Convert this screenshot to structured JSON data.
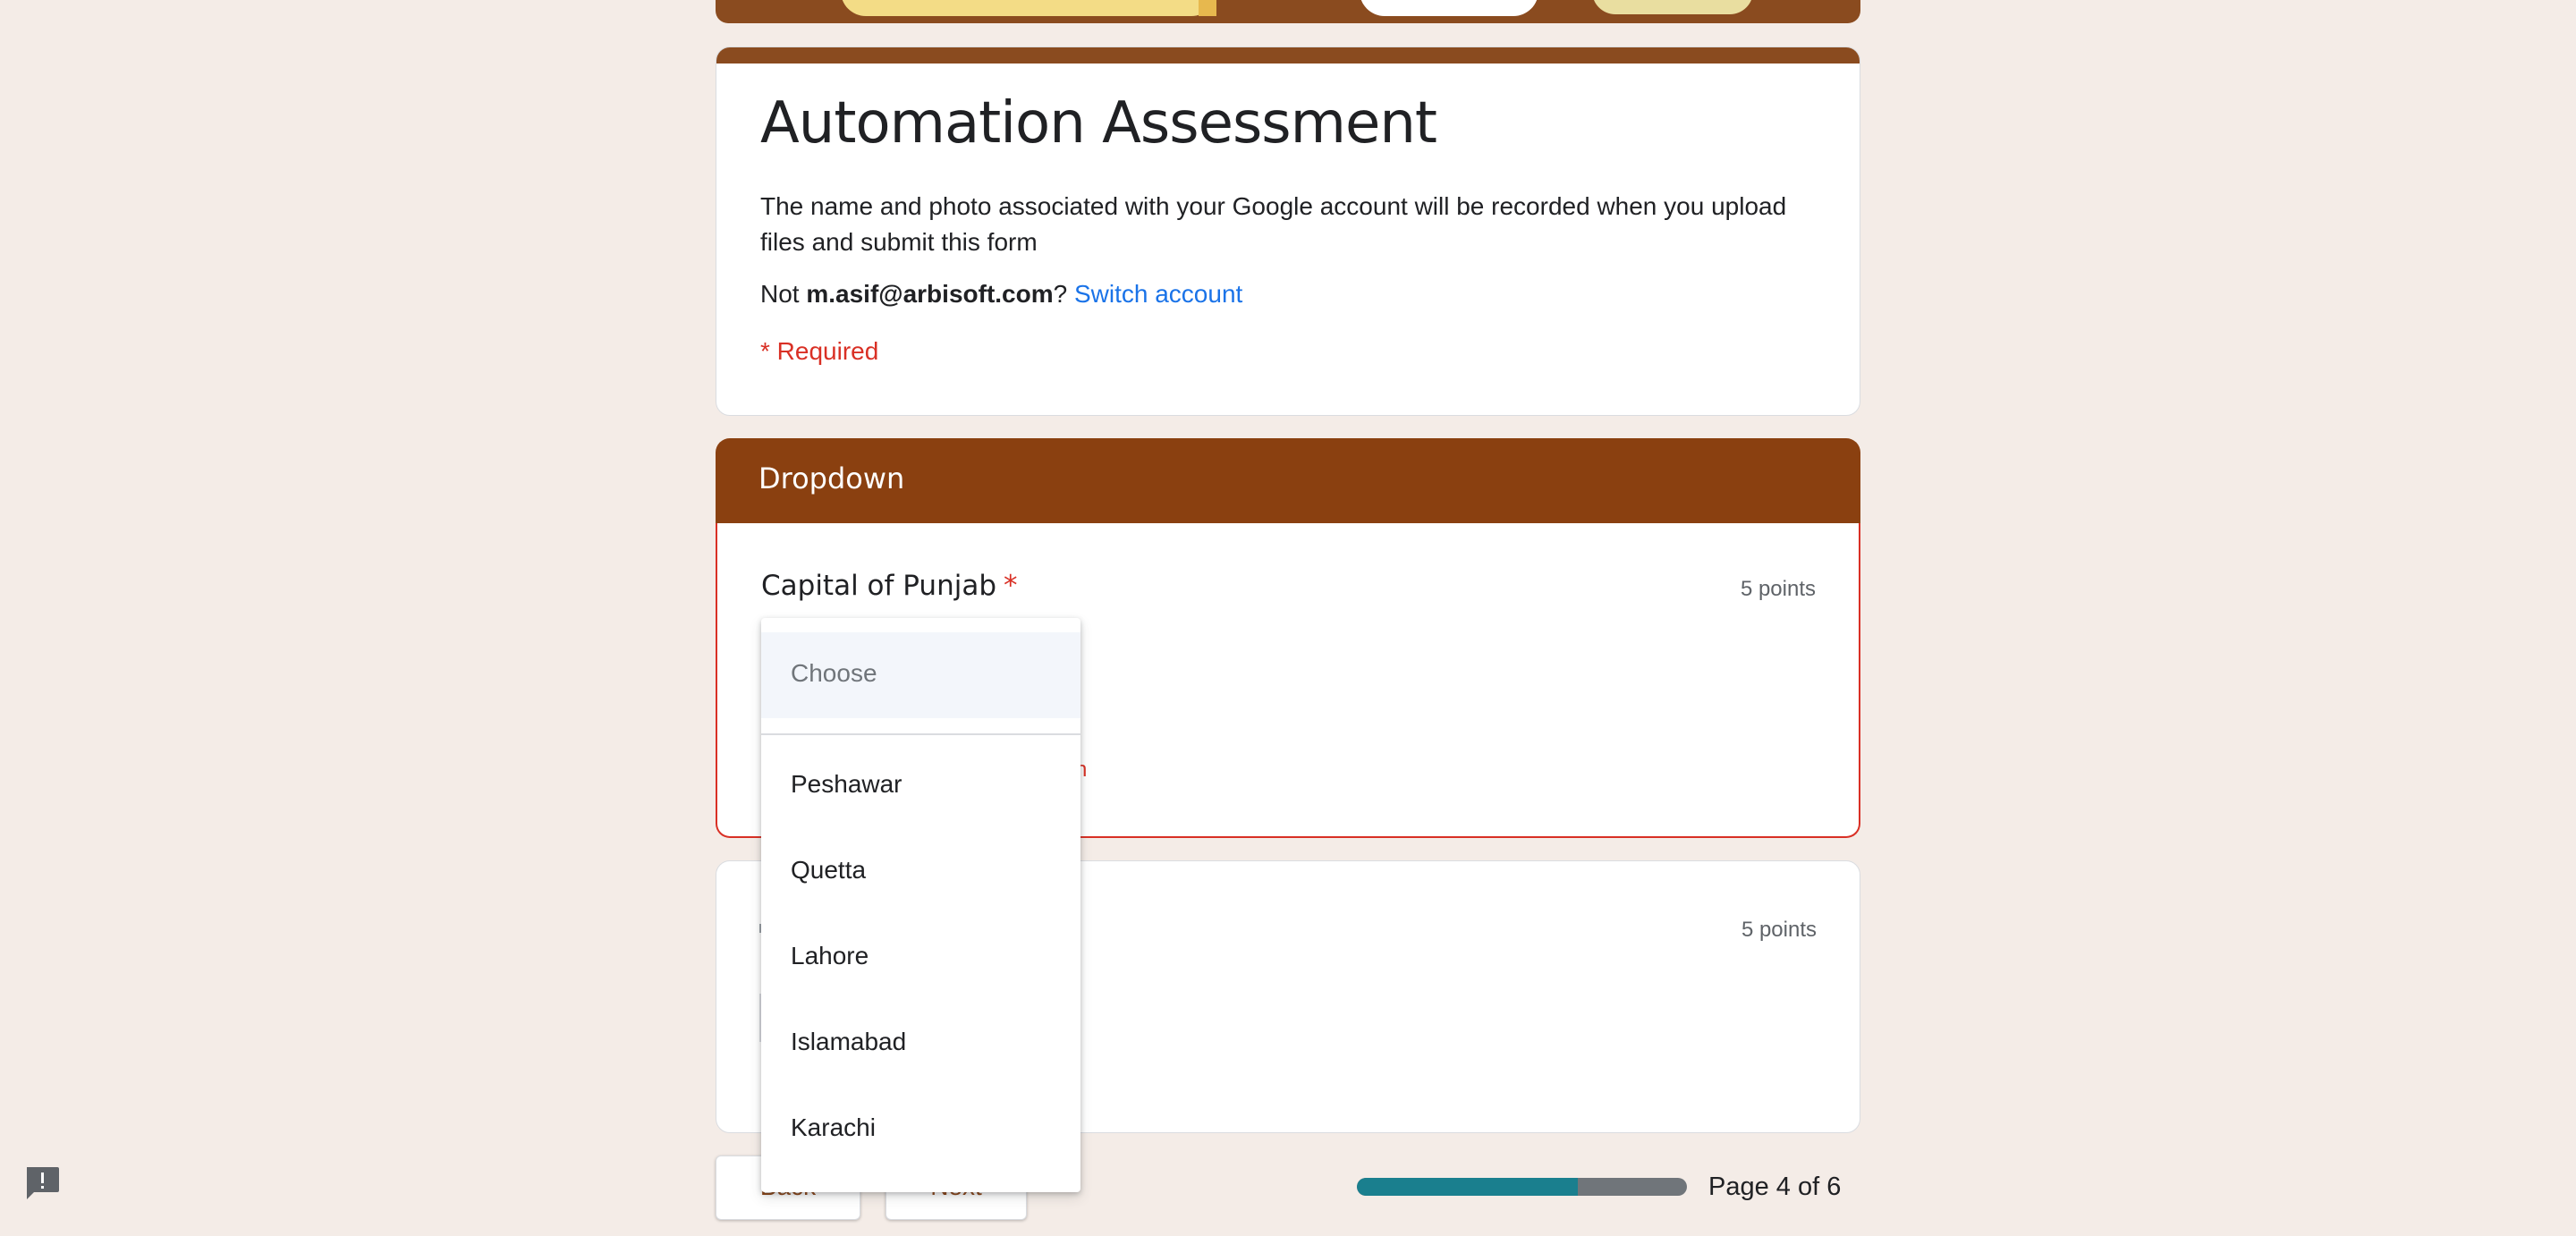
{
  "form": {
    "title": "Automation Assessment",
    "description": "The name and photo associated with your Google account will be recorded when you upload files and submit this form",
    "account_prefix": "Not ",
    "account_email": "m.asif@arbisoft.com",
    "account_suffix": "?",
    "switch_account": "Switch account",
    "required_note": "* Required"
  },
  "section": {
    "title": "Dropdown"
  },
  "question1": {
    "title": "Capital of Punjab",
    "required_mark": "*",
    "points": "5 points",
    "error_fragment": "n"
  },
  "question2": {
    "points": "5 points"
  },
  "dropdown": {
    "placeholder": "Choose",
    "options": [
      "Peshawar",
      "Quetta",
      "Lahore",
      "Islamabad",
      "Karachi"
    ]
  },
  "nav": {
    "back_label": "Back",
    "next_label": "Next",
    "page_indicator": "Page 4 of 6",
    "progress_fraction": 0.67
  },
  "colors": {
    "theme": "#8a4010",
    "error": "#d93025",
    "link": "#1a73e8",
    "progress": "#1a7f8e"
  },
  "icons": {
    "feedback": "report-icon"
  }
}
